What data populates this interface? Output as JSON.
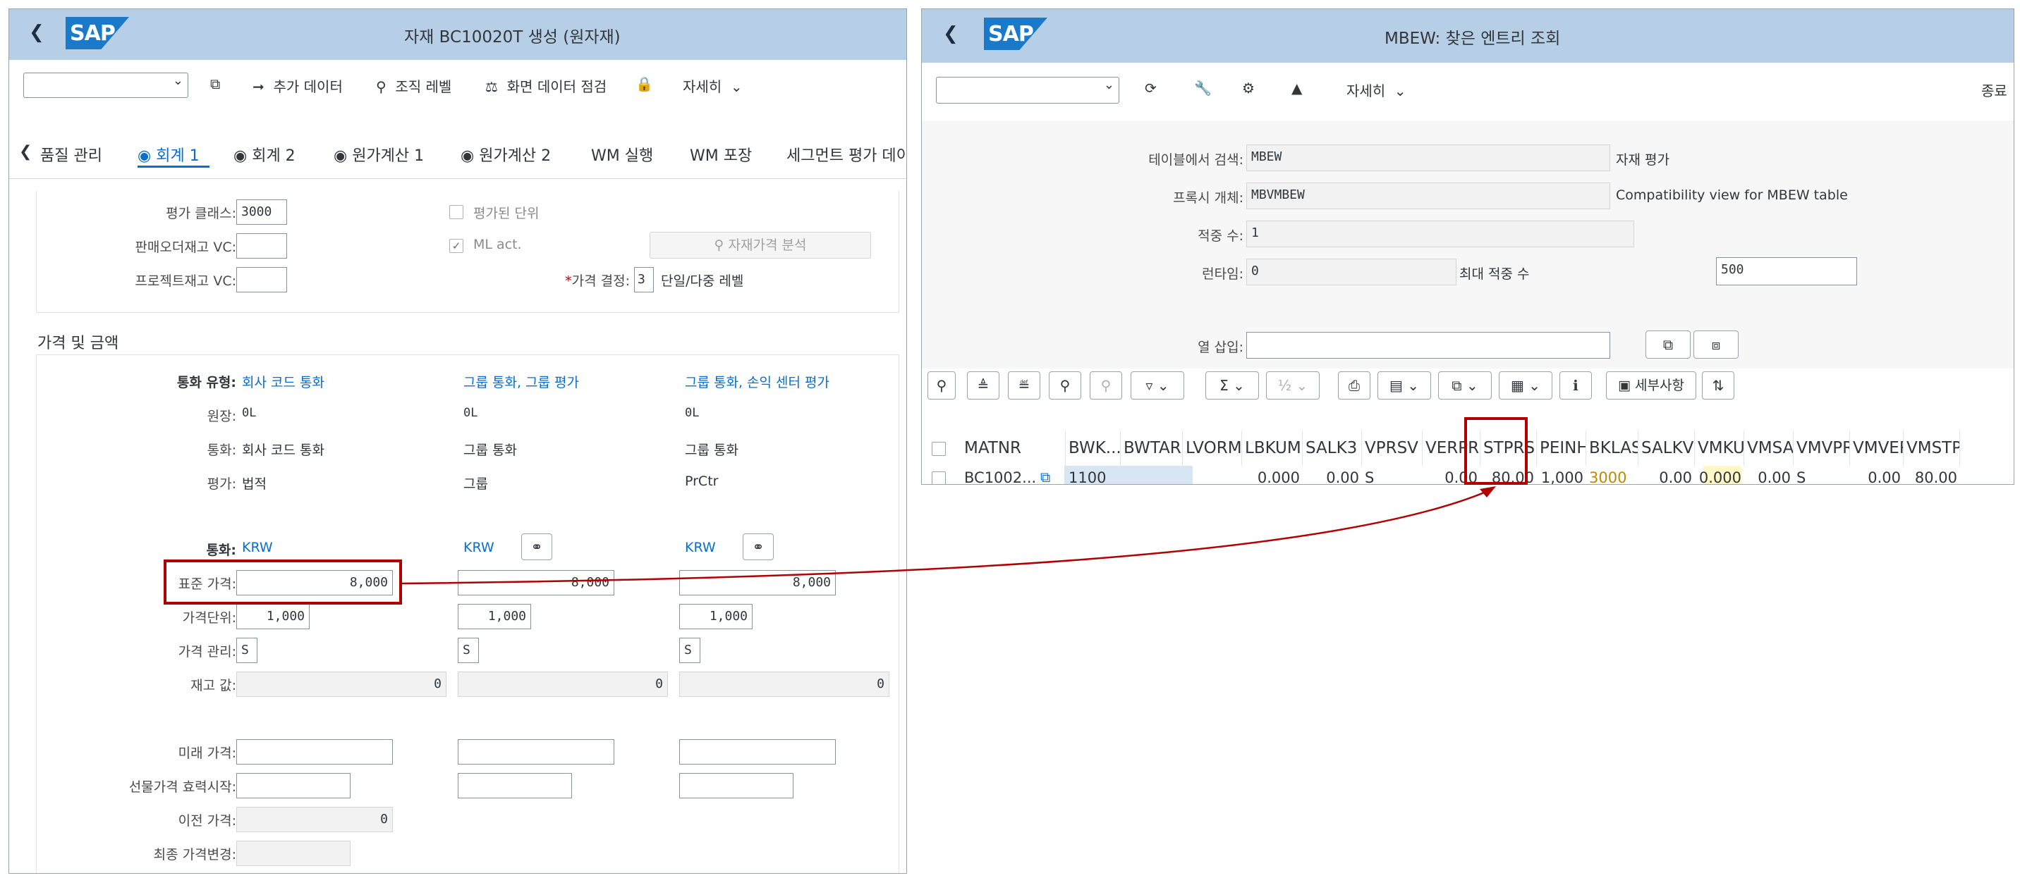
{
  "left": {
    "window_title": "자재 BC10020T 생성 (원자재)",
    "toolbar": {
      "additional_data": "추가 데이터",
      "org_levels": "조직 레벨",
      "check_screen_data": "화면 데이터 점검",
      "more": "자세히"
    },
    "tabs": [
      "품질 관리",
      "회계 1",
      "회계 2",
      "원가계산 1",
      "원가계산 2",
      "WM 실행",
      "WM 포장",
      "세그먼트 평가 데이"
    ],
    "top_section": {
      "valuation_class_label": "평가 클래스:",
      "valuation_class_value": "3000",
      "sales_order_vc_label": "판매오더재고 VC:",
      "project_vc_label": "프로젝트재고 VC:",
      "valuated_unit_label": "평가된 단위",
      "ml_act_label": "ML act.",
      "material_price_analysis": "자재가격 분석",
      "price_determination_label": "가격 결정:",
      "price_determination_value": "3",
      "price_determination_text": "단일/다중 레벨"
    },
    "price_section": {
      "title": "가격 및 금액",
      "currency_type_label": "통화 유형:",
      "ledger_label": "원장:",
      "currency_label": "통화:",
      "valuation_label": "평가:",
      "currency_code_label": "통화:",
      "standard_price_label": "표준 가격:",
      "price_unit_label": "가격단위:",
      "price_control_label": "가격 관리:",
      "stock_value_label": "재고 값:",
      "future_price_label": "미래 가격:",
      "future_price_valid_label": "선물가격 효력시작:",
      "previous_price_label": "이전 가격:",
      "last_price_change_label": "최종 가격변경:",
      "columns": [
        {
          "currency_type": "회사 코드 통화",
          "ledger": "0L",
          "currency": "회사 코드 통화",
          "valuation": "법적",
          "currency_code": "KRW",
          "standard_price": "8,000",
          "price_unit": "1,000",
          "price_control": "S",
          "stock_value": "0",
          "previous_price": "0"
        },
        {
          "currency_type": "그룹 통화, 그룹 평가",
          "ledger": "0L",
          "currency": "그룹 통화",
          "valuation": "그룹",
          "currency_code": "KRW",
          "standard_price": "8,000",
          "price_unit": "1,000",
          "price_control": "S",
          "stock_value": "0"
        },
        {
          "currency_type": "그룹 통화, 손익 센터 평가",
          "ledger": "0L",
          "currency": "그룹 통화",
          "valuation": "PrCtr",
          "currency_code": "KRW",
          "standard_price": "8,000",
          "price_unit": "1,000",
          "price_control": "S",
          "stock_value": "0"
        }
      ]
    }
  },
  "right": {
    "window_title": "MBEW: 찾은 엔트리 조회",
    "toolbar": {
      "more": "자세히",
      "exit": "종료"
    },
    "fields": {
      "search_table_label": "테이블에서 검색:",
      "search_table_value": "MBEW",
      "search_table_desc": "자재 평가",
      "proxy_label": "프록시 개체:",
      "proxy_value": "MBVMBEW",
      "proxy_desc": "Compatibility view for MBEW table",
      "hits_label": "적중 수:",
      "hits_value": "1",
      "runtime_label": "런타임:",
      "runtime_value": "0",
      "max_hits_label": "최대 적중 수",
      "max_hits_value": "500",
      "column_insert_label": "열 삽입:"
    },
    "grid": {
      "details_button": "세부사항",
      "headers": [
        "MATNR",
        "BWK...",
        "BWTAR",
        "LVORM",
        "LBKUM",
        "SALK3",
        "VPRSV",
        "VERPR",
        "STPRS",
        "PEINH",
        "BKLAS",
        "SALKV",
        "VMKUM",
        "VMSAL",
        "VMVPR",
        "VMVER",
        "VMSTP"
      ],
      "row": [
        "BC1002...",
        "1100",
        "",
        "",
        "0.000",
        "0.00",
        "S",
        "0.00",
        "80.00",
        "1,000",
        "3000",
        "0.00",
        "0.000",
        "0.00",
        "S",
        "0.00",
        "80.00"
      ]
    }
  },
  "colors": {
    "shell": "#b7cfe6",
    "link": "#0a6ed1",
    "highlight": "#b00000",
    "bklas_bg": "#fff7c7",
    "row_select": "#d8e6f4"
  }
}
